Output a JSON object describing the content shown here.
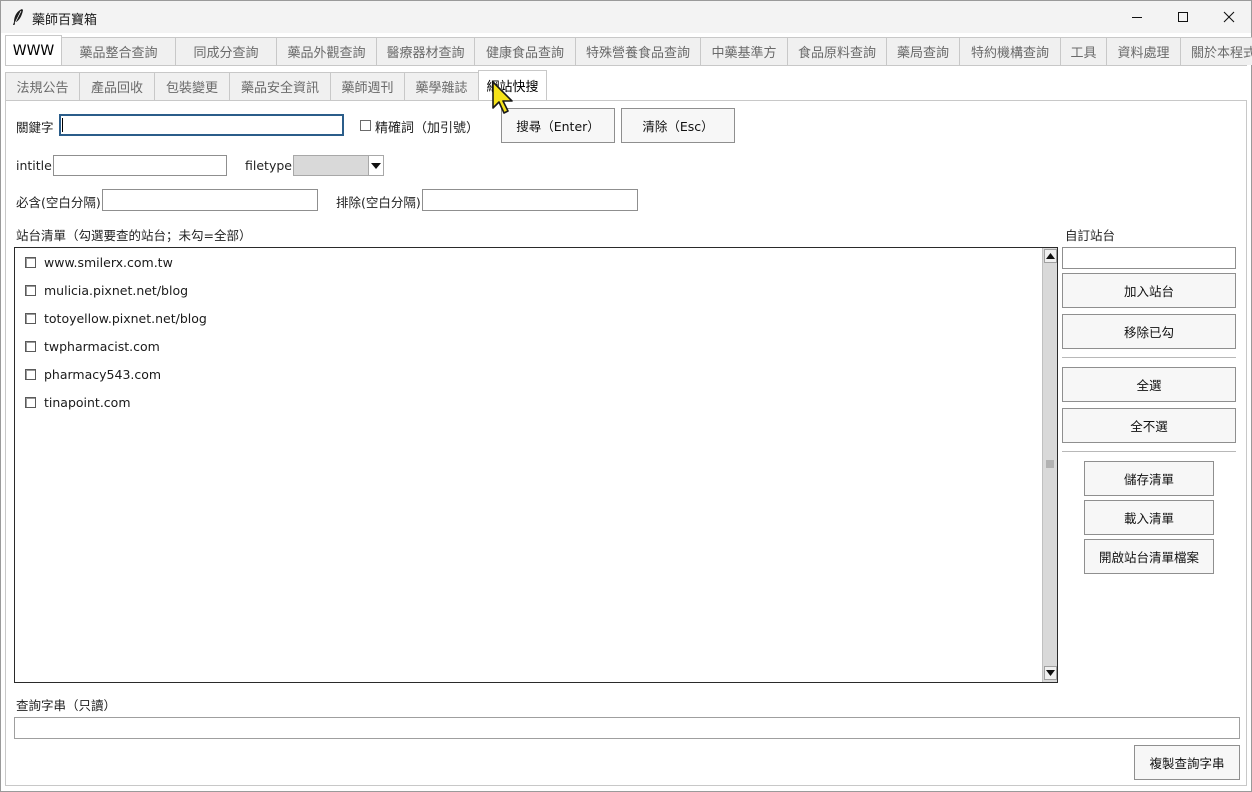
{
  "window": {
    "title": "藥師百寶箱"
  },
  "tabs_main": [
    {
      "label": "WWW",
      "active": true
    },
    {
      "label": "藥品整合查詢"
    },
    {
      "label": "同成分查詢"
    },
    {
      "label": "藥品外觀查詢"
    },
    {
      "label": "醫療器材查詢"
    },
    {
      "label": "健康食品查詢"
    },
    {
      "label": "特殊營養食品查詢"
    },
    {
      "label": "中藥基準方"
    },
    {
      "label": "食品原料查詢"
    },
    {
      "label": "藥局查詢"
    },
    {
      "label": "特約機構查詢"
    },
    {
      "label": "工具"
    },
    {
      "label": "資料處理"
    },
    {
      "label": "關於本程式"
    }
  ],
  "tabs_sub": [
    {
      "label": "法規公告"
    },
    {
      "label": "產品回收"
    },
    {
      "label": "包裝變更"
    },
    {
      "label": "藥品安全資訊"
    },
    {
      "label": "藥師週刊"
    },
    {
      "label": "藥學雜誌"
    },
    {
      "label": "網站快搜",
      "active": true
    }
  ],
  "form": {
    "keyword_label": "關鍵字",
    "keyword_value": "",
    "exact_label": "精確詞（加引號）",
    "search_button": "搜尋（Enter）",
    "clear_button": "清除（Esc）",
    "intitle_label": "intitle",
    "filetype_label": "filetype",
    "filetype_value": "",
    "include_label": "必含(空白分隔)",
    "exclude_label": "排除(空白分隔)"
  },
  "sites": {
    "header": "站台清單（勾選要查的站台；未勾=全部）",
    "items": [
      {
        "label": "www.smilerx.com.tw",
        "checked": false
      },
      {
        "label": "mulicia.pixnet.net/blog",
        "checked": false
      },
      {
        "label": "totoyellow.pixnet.net/blog",
        "checked": false
      },
      {
        "label": "twpharmacist.com",
        "checked": false
      },
      {
        "label": "pharmacy543.com",
        "checked": false
      },
      {
        "label": "tinapoint.com",
        "checked": false
      }
    ]
  },
  "side": {
    "custom_label": "自訂站台",
    "custom_value": "",
    "add_button": "加入站台",
    "remove_button": "移除已勾",
    "select_all_button": "全選",
    "select_none_button": "全不選",
    "save_button": "儲存清單",
    "load_button": "載入清單",
    "open_file_button": "開啟站台清單檔案"
  },
  "query": {
    "label": "查詢字串（只讀）",
    "value": "",
    "copy_button": "複製查詢字串"
  },
  "icons": [
    "feather-icon",
    "minimize-icon",
    "maximize-icon",
    "close-icon",
    "chevron-down-icon",
    "scroll-up-icon",
    "scroll-down-icon",
    "grip-icon",
    "pointer-cursor-icon"
  ]
}
